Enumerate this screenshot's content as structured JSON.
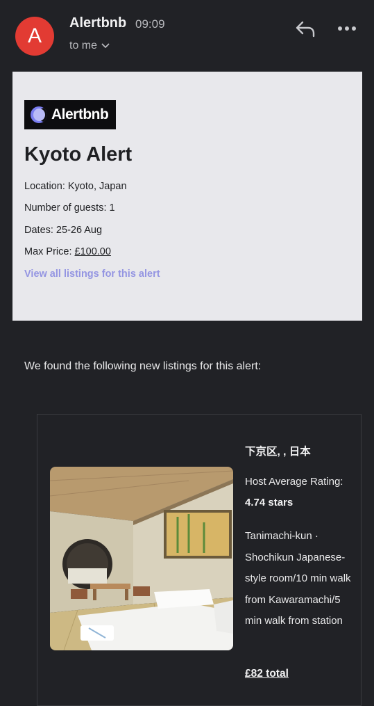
{
  "header": {
    "avatar_letter": "A",
    "sender": "Alertbnb",
    "time": "09:09",
    "recipient": "to me",
    "reply_icon": "reply-icon",
    "more_icon": "more-icon"
  },
  "alert": {
    "logo_text": "Alertbnb",
    "title": "Kyoto Alert",
    "location": "Location: Kyoto, Japan",
    "guests": "Number of guests: 1",
    "dates": "Dates: 25-26 Aug",
    "max_price_label": "Max Price: ",
    "max_price_value": "£100.00",
    "view_all_link": "View all listings for this alert"
  },
  "intro": "We found the following new listings for this alert:",
  "listing": {
    "location": "下京区, , 日本",
    "rating_label": "Host Average Rating:",
    "rating_value": "4.74 stars",
    "description": "Tanimachi-kun · Shochikun Japanese-style room/10 min walk from Kawaramachi/5 min walk from station",
    "total": "£82 total"
  },
  "colors": {
    "background": "#212226",
    "avatar": "#e23b33",
    "card": "#e8e8ec",
    "link": "#9495e2"
  }
}
